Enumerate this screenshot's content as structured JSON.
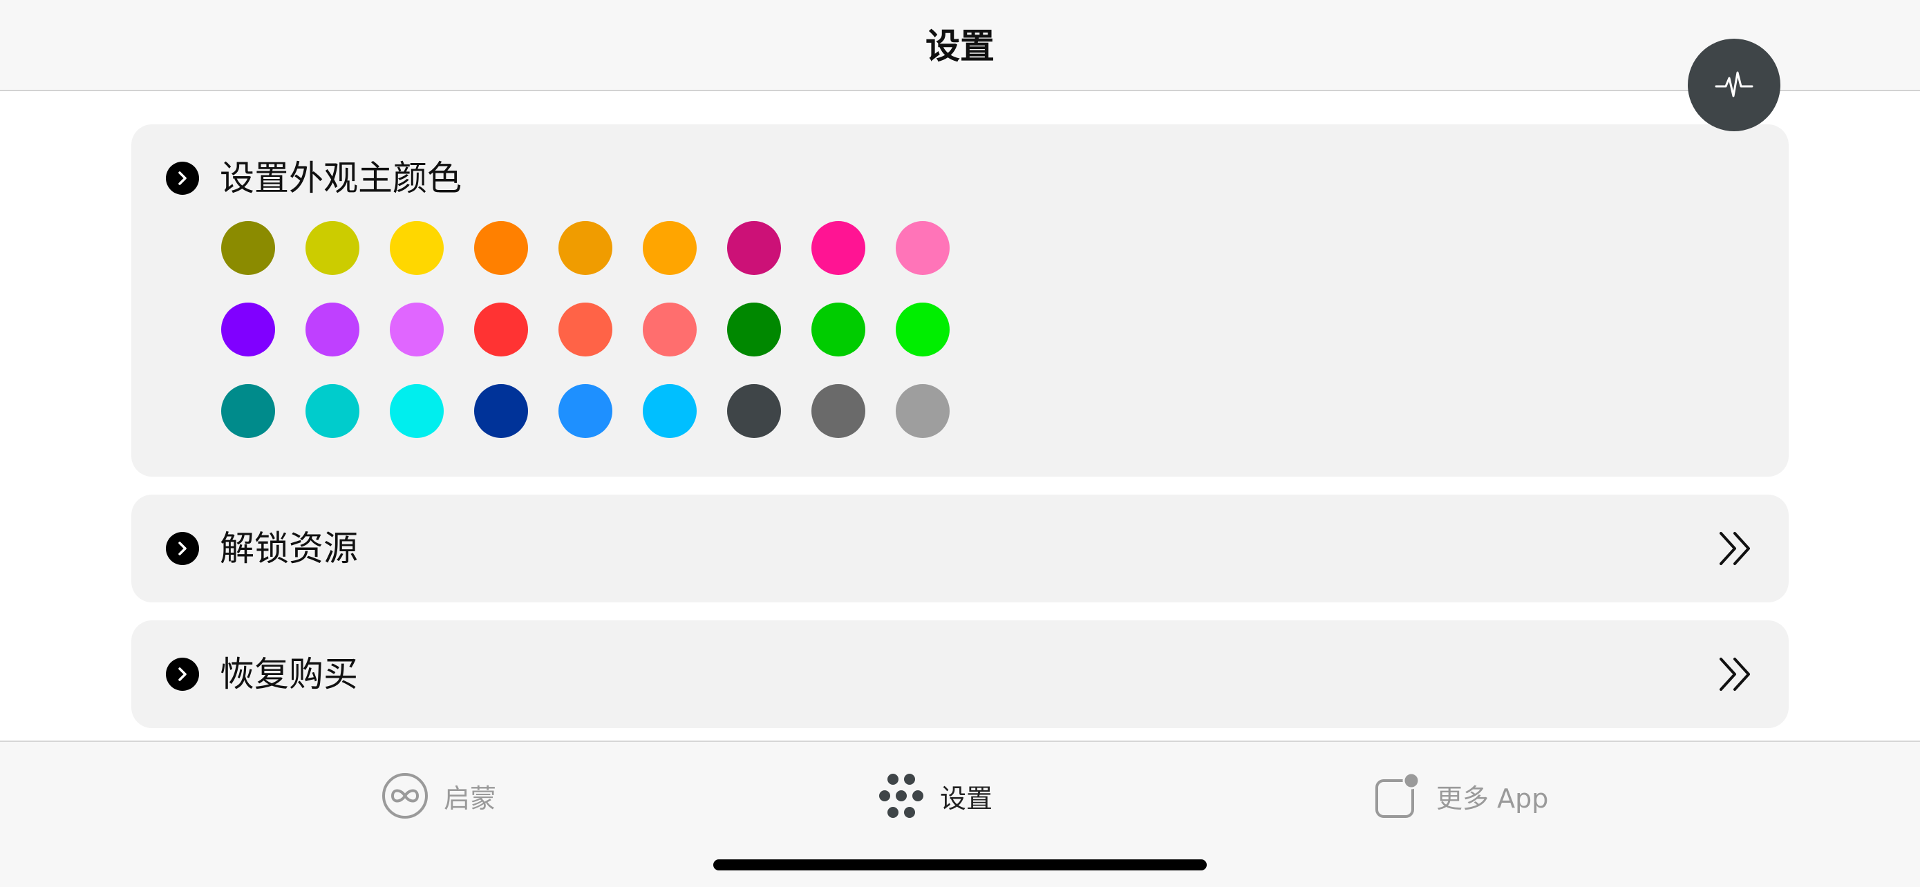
{
  "header": {
    "title": "设置"
  },
  "fab": {
    "icon": "activity-pulse-icon"
  },
  "sections": {
    "appearance": {
      "label": "设置外观主颜色",
      "colors": [
        "#8b8b00",
        "#cccc00",
        "#ffd700",
        "#ff8000",
        "#f09c00",
        "#ffa500",
        "#cc1177",
        "#ff1493",
        "#ff74b8",
        "#8000ff",
        "#bf40ff",
        "#e066ff",
        "#ff3333",
        "#ff6347",
        "#ff6e6e",
        "#008800",
        "#00cc00",
        "#00ee00",
        "#008b8b",
        "#00cccc",
        "#00eeee",
        "#003399",
        "#1e90ff",
        "#00bfff",
        "#3f4548",
        "#6a6a6a",
        "#9e9e9e"
      ]
    },
    "unlock": {
      "label": "解锁资源"
    },
    "restore": {
      "label": "恢复购买"
    }
  },
  "tabbar": {
    "tabs": [
      {
        "label": "启蒙",
        "icon": "infinity-icon",
        "active": false
      },
      {
        "label": "设置",
        "icon": "dots-cluster-icon",
        "active": true
      },
      {
        "label": "更多 App",
        "icon": "app-badge-icon",
        "active": false
      }
    ]
  },
  "colors": {
    "accent": "#3f4548",
    "card_background": "#f2f2f2",
    "inactive_tab": "#9a9a9a"
  }
}
